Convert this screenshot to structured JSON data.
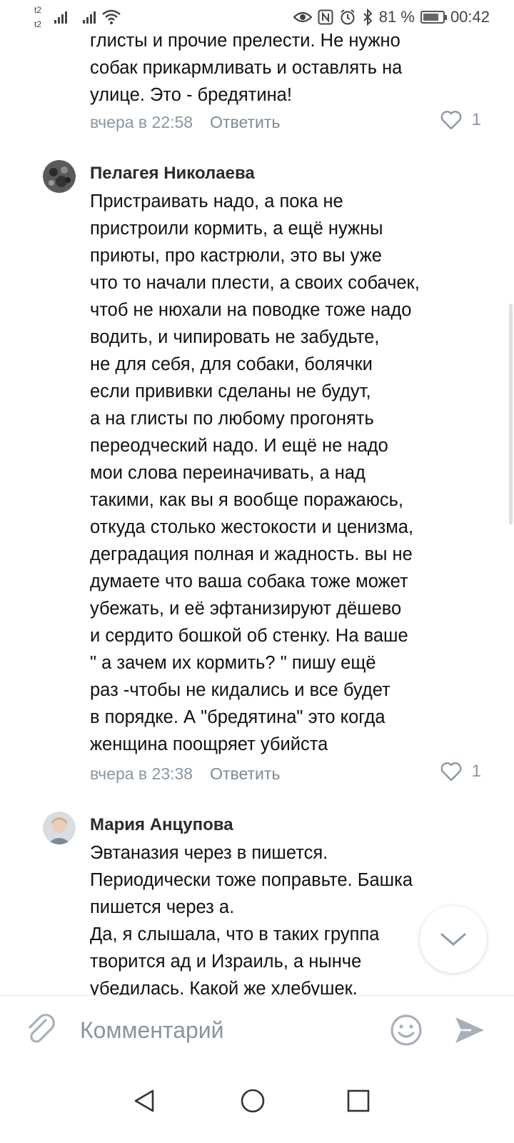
{
  "status_bar": {
    "carrier1": "t2",
    "carrier2": "t2",
    "battery": "81 %",
    "battery_level": 0.81,
    "time": "00:42"
  },
  "comments": [
    {
      "author": "",
      "lines": [
        "глисты и прочие прелести. Не нужно",
        "собак прикармливать и оставлять на",
        "улице. Это - бредятина!"
      ],
      "date": "вчера в 22:58",
      "reply": "Ответить",
      "likes": "1"
    },
    {
      "author": "Пелагея Николаева",
      "lines": [
        "Пристраивать надо, а пока не",
        "пристроили кормить, а ещё нужны",
        "приюты, про кастрюли, это вы уже",
        "что то начали плести, а своих собачек,",
        "чтоб не нюхали на поводке тоже надо",
        "водить, и чипировать не забудьте,",
        "не для себя, для собаки, болячки",
        "если прививки сделаны не будут,",
        "а на глисты по любому прогонять",
        "переодческий надо. И ещё не надо",
        "мои слова переиначивать, а над",
        "такими, как вы я вообще поражаюсь,",
        "откуда столько жестокости и ценизма,",
        "деградация полная и жадность. вы не",
        "думаете что ваша собака тоже может",
        "убежать, и её эфтанизируют дёшево",
        "и сердито бошкой об стенку. На ваше",
        "\" а зачем их кормить? \" пишу ещё",
        "раз -чтобы не кидались и все будет",
        "в порядке. А \"бредятина\" это когда",
        "женщина поощряет убийста"
      ],
      "date": "вчера в 23:38",
      "reply": "Ответить",
      "likes": "1"
    },
    {
      "author": "Мария Анцупова",
      "lines": [
        "Эвтаназия через в пишется.",
        "Периодически тоже поправьте. Башка",
        "пишется через а.",
        "Да, я слышала, что в таких группа",
        "творится ад и Израиль, а нынче",
        "убедилась. Какой же хлебушек."
      ]
    }
  ],
  "composer": {
    "placeholder": "Комментарий"
  },
  "icons": {
    "attach": "paperclip-icon",
    "emoji": "smiley-icon",
    "send": "send-arrow-icon",
    "scroll_down": "chevron-down-icon",
    "like": "heart-icon",
    "nav_back": "triangle-back-icon",
    "nav_home": "circle-home-icon",
    "nav_recent": "square-recents-icon"
  },
  "colors": {
    "meta_text": "#8a96a3",
    "icon_gray": "#a7b0ba"
  }
}
